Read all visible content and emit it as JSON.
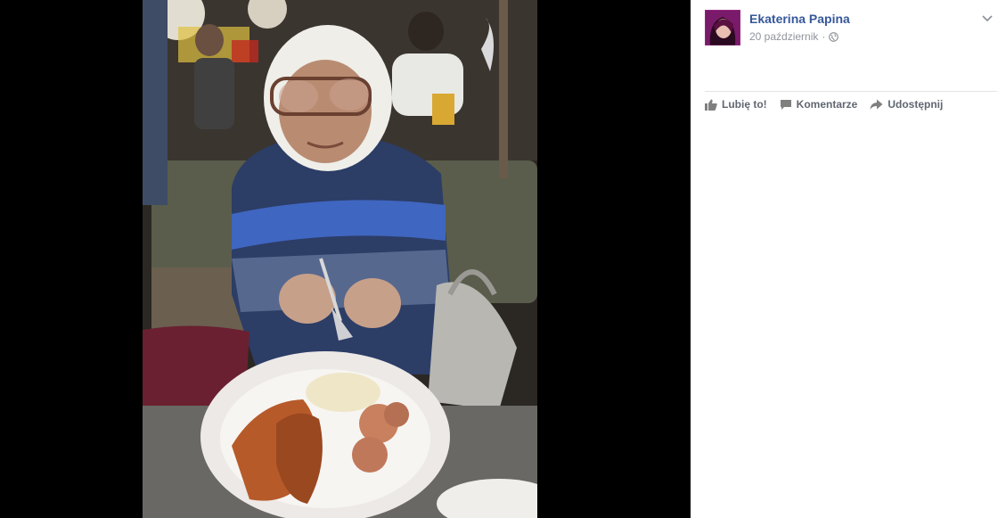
{
  "post": {
    "author_name": "Ekaterina Papina",
    "date": "20 październik",
    "separator": "·",
    "privacy_icon": "public-globe-icon",
    "options_icon": "chevron-down-icon"
  },
  "actions": {
    "like_label": "Lubię to!",
    "comment_label": "Komentarze",
    "share_label": "Udostępnij",
    "like_icon": "thumbs-up-icon",
    "comment_icon": "speech-bubble-icon",
    "share_icon": "share-arrow-icon"
  },
  "colors": {
    "author_link": "#365899",
    "meta_text": "#90949c",
    "action_text": "#606770",
    "viewer_bg": "#000000"
  }
}
